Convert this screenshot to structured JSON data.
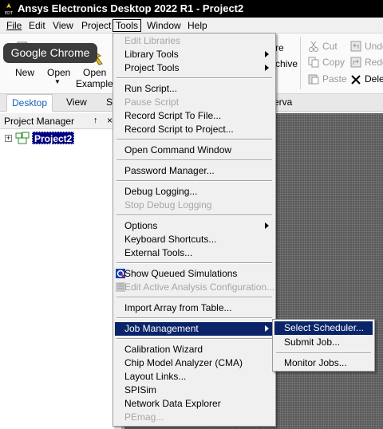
{
  "titlebar": {
    "title": "Ansys Electronics Desktop 2022 R1 - Project2",
    "icon": "edt-logo-icon",
    "icon_caption": "EDT"
  },
  "menubar": {
    "items": [
      {
        "label": "File"
      },
      {
        "label": "Edit"
      },
      {
        "label": "View"
      },
      {
        "label": "Project"
      },
      {
        "label": "Tools"
      },
      {
        "label": "Window"
      },
      {
        "label": "Help"
      }
    ]
  },
  "ribbon": {
    "new_label": "New",
    "open_label": "Open",
    "open_examples_line1": "Open",
    "open_examples_line2": "Examples",
    "partial_save_label": "re",
    "partial_archive_label": "chive",
    "cut_label": "Cut",
    "copy_label": "Copy",
    "paste_label": "Paste",
    "undo_label": "Undo",
    "redo_label": "Redo",
    "delete_label": "Delet"
  },
  "tabs": [
    {
      "label": "Desktop"
    },
    {
      "label": "View"
    },
    {
      "label": "S"
    },
    {
      "label": "erva"
    }
  ],
  "tooltip": {
    "text": "Google Chrome"
  },
  "project_manager": {
    "title": "Project Manager",
    "pin": "↑",
    "close": "×",
    "tree": {
      "expander": "+",
      "project_name": "Project2"
    }
  },
  "tools_menu": {
    "items": [
      {
        "label": "Edit Libraries",
        "disabled": true
      },
      {
        "label": "Library Tools",
        "submenu": true
      },
      {
        "label": "Project Tools",
        "submenu": true
      },
      {
        "label": "Run Script..."
      },
      {
        "label": "Pause Script",
        "disabled": true
      },
      {
        "label": "Record Script To File..."
      },
      {
        "label": "Record Script to Project..."
      },
      {
        "label": "Open Command Window"
      },
      {
        "label": "Password Manager..."
      },
      {
        "label": "Debug Logging..."
      },
      {
        "label": "Stop Debug Logging",
        "disabled": true
      },
      {
        "label": "Options",
        "submenu": true
      },
      {
        "label": "Keyboard Shortcuts..."
      },
      {
        "label": "External Tools..."
      },
      {
        "label": "Show Queued Simulations",
        "icon": "queued-simulations-icon"
      },
      {
        "label": "Edit Active Analysis Configuration...",
        "disabled": true,
        "icon": "analysis-config-icon"
      },
      {
        "label": "Import Array from Table..."
      },
      {
        "label": "Job Management",
        "submenu": true,
        "highlight": true
      },
      {
        "label": "Calibration Wizard"
      },
      {
        "label": "Chip Model Analyzer (CMA)"
      },
      {
        "label": "Layout Links..."
      },
      {
        "label": "SPISim"
      },
      {
        "label": "Network Data Explorer"
      },
      {
        "label": "PEmag...",
        "disabled": true
      }
    ]
  },
  "job_menu": {
    "items": [
      {
        "label": "Select Scheduler...",
        "highlight": true
      },
      {
        "label": "Submit Job..."
      },
      {
        "label": "Monitor Jobs..."
      }
    ]
  },
  "colors": {
    "highlight": "#0a246a",
    "accent": "#1a5fb4",
    "titlebar": "#000000"
  }
}
